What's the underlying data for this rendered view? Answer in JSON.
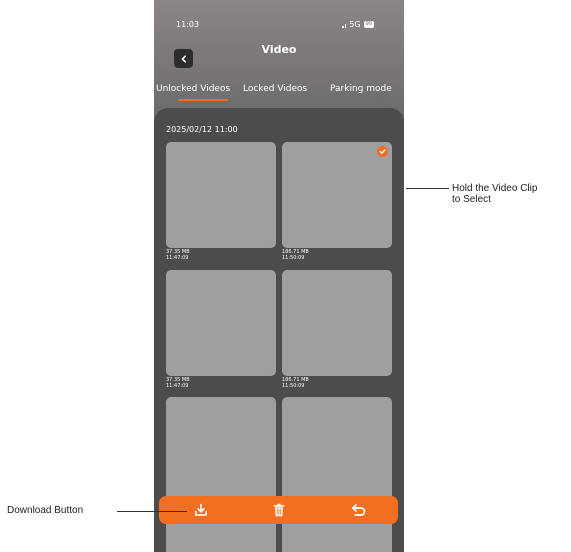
{
  "status_bar": {
    "time": "11:03",
    "network": "5G",
    "battery": "90"
  },
  "header": {
    "title": "Video"
  },
  "tabs": [
    {
      "label": "Unlocked Videos",
      "active": true
    },
    {
      "label": "Locked Videos",
      "active": false
    },
    {
      "label": "Parking mode",
      "active": false
    }
  ],
  "group": {
    "date": "2025/02/12 11:00"
  },
  "clips": [
    {
      "size": "37.35 MB",
      "time": "11:47:09",
      "selected": false
    },
    {
      "size": "186.71 MB",
      "time": "11:50:09",
      "selected": true
    },
    {
      "size": "37.35 MB",
      "time": "11:47:09",
      "selected": false
    },
    {
      "size": "186.71 MB",
      "time": "11:50:09",
      "selected": false
    },
    {
      "size": "",
      "time": "",
      "selected": false
    },
    {
      "size": "",
      "time": "",
      "selected": false
    }
  ],
  "toolbar": {
    "icons": [
      "download-icon",
      "trash-icon",
      "undo-icon"
    ]
  },
  "annotations": {
    "select_hint_line1": "Hold the Video Clip",
    "select_hint_line2": "to Select",
    "download_label": "Download Button"
  },
  "colors": {
    "accent": "#f26f21",
    "panel": "#4c4c4c",
    "thumb": "#a09f9f"
  }
}
